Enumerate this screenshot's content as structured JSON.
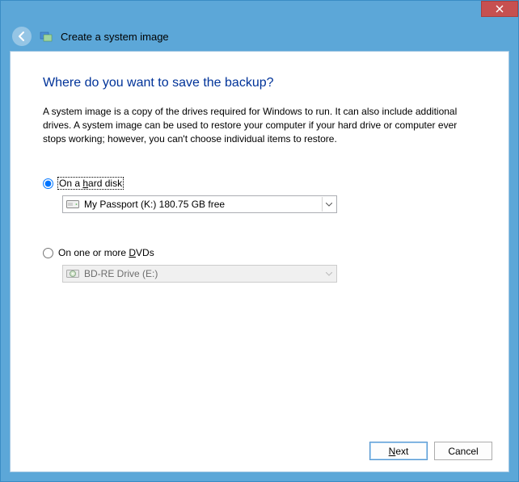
{
  "header": {
    "title": "Create a system image"
  },
  "main": {
    "heading": "Where do you want to save the backup?",
    "description": "A system image is a copy of the drives required for Windows to run. It can also include additional drives. A system image can be used to restore your computer if your hard drive or computer ever stops working; however, you can't choose individual items to restore."
  },
  "options": {
    "harddisk": {
      "label_pre": "On a ",
      "label_u": "h",
      "label_post": "ard disk",
      "selected": "My Passport (K:)  180.75 GB free"
    },
    "dvd": {
      "label_pre": "On one or more ",
      "label_u": "D",
      "label_post": "VDs",
      "selected": "BD-RE Drive (E:)"
    }
  },
  "footer": {
    "next_u": "N",
    "next_post": "ext",
    "cancel": "Cancel"
  }
}
